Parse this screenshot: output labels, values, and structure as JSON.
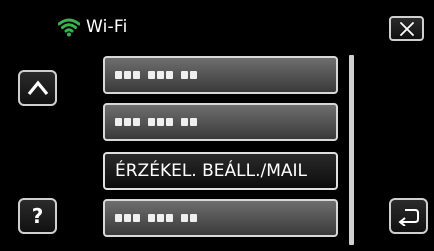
{
  "header": {
    "title": "Wi-Fi",
    "icon": "wifi-icon",
    "icon_color": "#37b24d"
  },
  "menu": {
    "items": [
      {
        "label": "",
        "masked": true
      },
      {
        "label": "",
        "masked": true
      },
      {
        "label": "ÉRZÉKEL. BEÁLL./MAIL",
        "masked": false
      },
      {
        "label": "",
        "masked": true
      }
    ]
  },
  "buttons": {
    "close_icon": "close-icon",
    "up_icon": "chevron-up-icon",
    "help_label": "?",
    "back_icon": "back-arrow-icon"
  }
}
